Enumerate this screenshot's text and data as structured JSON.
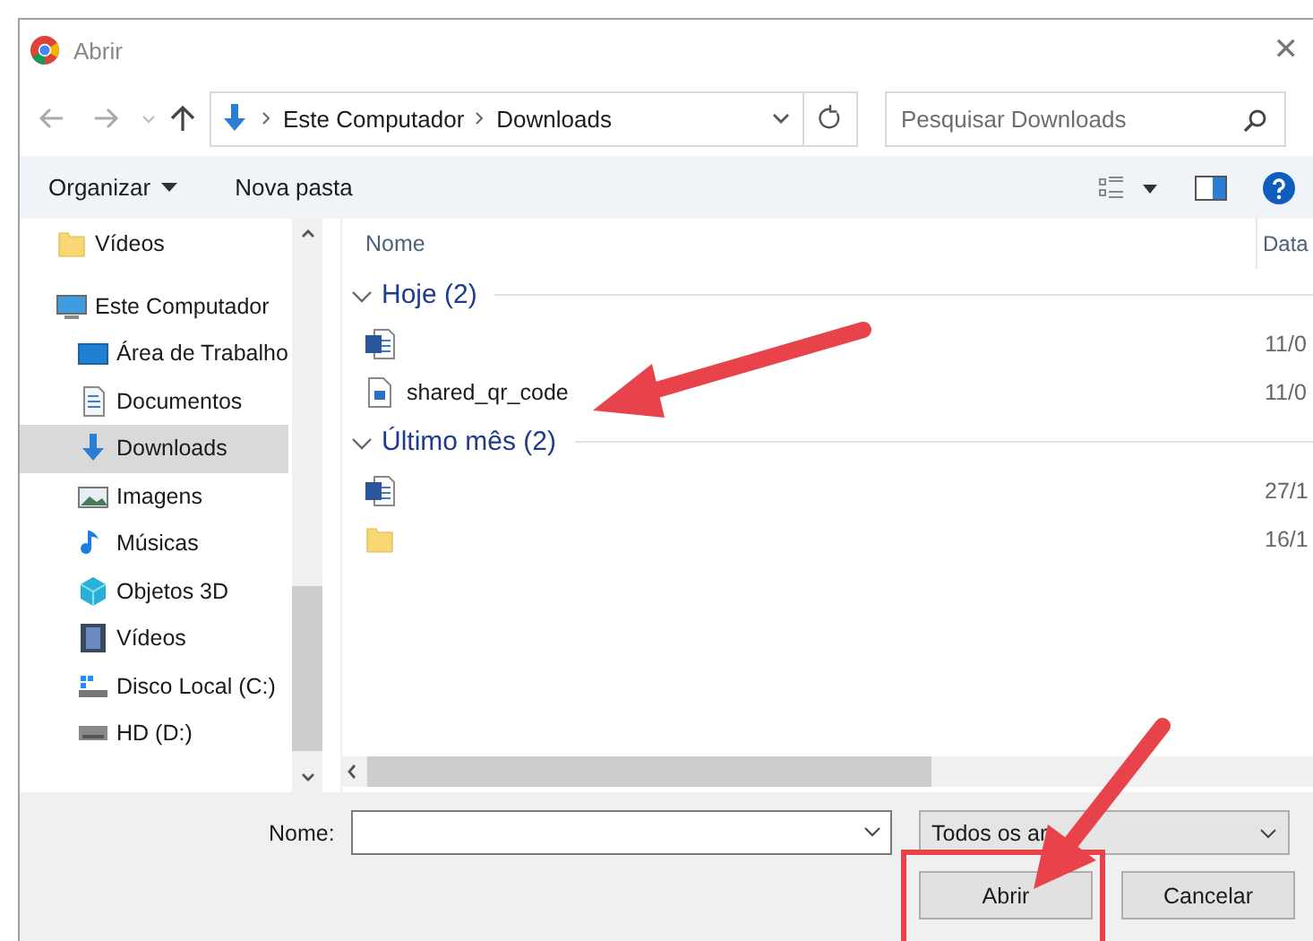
{
  "window": {
    "title": "Abrir",
    "close": "✕"
  },
  "address": {
    "path": [
      "Este Computador",
      "Downloads"
    ]
  },
  "search": {
    "placeholder": "Pesquisar Downloads"
  },
  "toolbar": {
    "organize": "Organizar",
    "new_folder": "Nova pasta"
  },
  "sidebar": {
    "items": [
      {
        "label": "Vídeos",
        "kind": "folder",
        "selected": false
      },
      {
        "label": "Este Computador",
        "kind": "computer",
        "selected": false,
        "children": [
          {
            "label": "Área de Trabalho",
            "kind": "desktop",
            "selected": false
          },
          {
            "label": "Documentos",
            "kind": "documents",
            "selected": false
          },
          {
            "label": "Downloads",
            "kind": "downloads",
            "selected": true
          },
          {
            "label": "Imagens",
            "kind": "pictures",
            "selected": false
          },
          {
            "label": "Músicas",
            "kind": "music",
            "selected": false
          },
          {
            "label": "Objetos 3D",
            "kind": "objects3d",
            "selected": false
          },
          {
            "label": "Vídeos",
            "kind": "videos",
            "selected": false
          },
          {
            "label": "Disco Local (C:)",
            "kind": "disk_c",
            "selected": false
          },
          {
            "label": "HD (D:)",
            "kind": "disk",
            "selected": false
          }
        ]
      }
    ]
  },
  "columns": [
    "Nome",
    "Data"
  ],
  "groups": [
    {
      "label": "Hoje (2)",
      "expanded": true,
      "files": [
        {
          "kind": "word",
          "date": "11/0"
        },
        {
          "kind": "image",
          "name": "shared_qr_code",
          "date": "11/0"
        }
      ]
    },
    {
      "label": "Último mês (2)",
      "expanded": true,
      "files": [
        {
          "kind": "word",
          "date": "27/1"
        },
        {
          "kind": "folder",
          "date": "16/1"
        }
      ]
    }
  ],
  "footer": {
    "name_label": "Nome:",
    "filter": "Todos os ar",
    "buttons": [
      {
        "label": "Abrir",
        "highlighted": true
      },
      {
        "label": "Cancelar",
        "highlighted": false
      }
    ]
  }
}
